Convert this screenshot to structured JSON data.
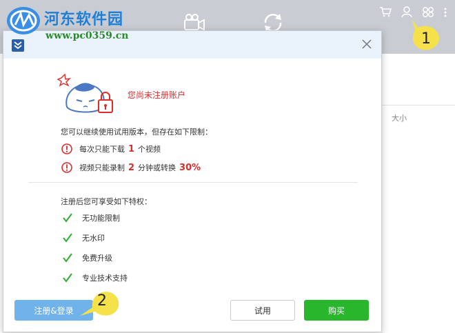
{
  "watermark": {
    "title": "河东软件园",
    "url": "www.pc0359.cn"
  },
  "app": {
    "column_size_label": "大小",
    "toolbar_icons": [
      "video-camera-icon",
      "refresh-icon"
    ],
    "header_icons": [
      "cart-icon",
      "user-icon",
      "settings-icon",
      "more-icon"
    ]
  },
  "dialog": {
    "status": "您尚未注册账户",
    "intro": "您可以继续使用试用版本，但存在如下限制：",
    "limits": [
      {
        "prefix": "每次只能下载",
        "num": "1",
        "suffix": "个视频",
        "extra": ""
      },
      {
        "prefix": "视频只能录制",
        "num": "2",
        "suffix": "分钟或转换",
        "extra": "30%"
      }
    ],
    "benefits_title": "注册后您可享受如下特权：",
    "benefits": [
      "无功能限制",
      "无水印",
      "免费升级",
      "专业技术支持"
    ],
    "buttons": {
      "register": "注册&登录",
      "trial": "试用",
      "buy": "购买"
    }
  },
  "callouts": [
    "1",
    "2"
  ],
  "colors": {
    "accent_blue": "#6fb3ea",
    "buy_green": "#29b52c",
    "warning_red": "#e02b2b",
    "check_green": "#2fae2f",
    "callout_yellow": "#f5e14a"
  }
}
